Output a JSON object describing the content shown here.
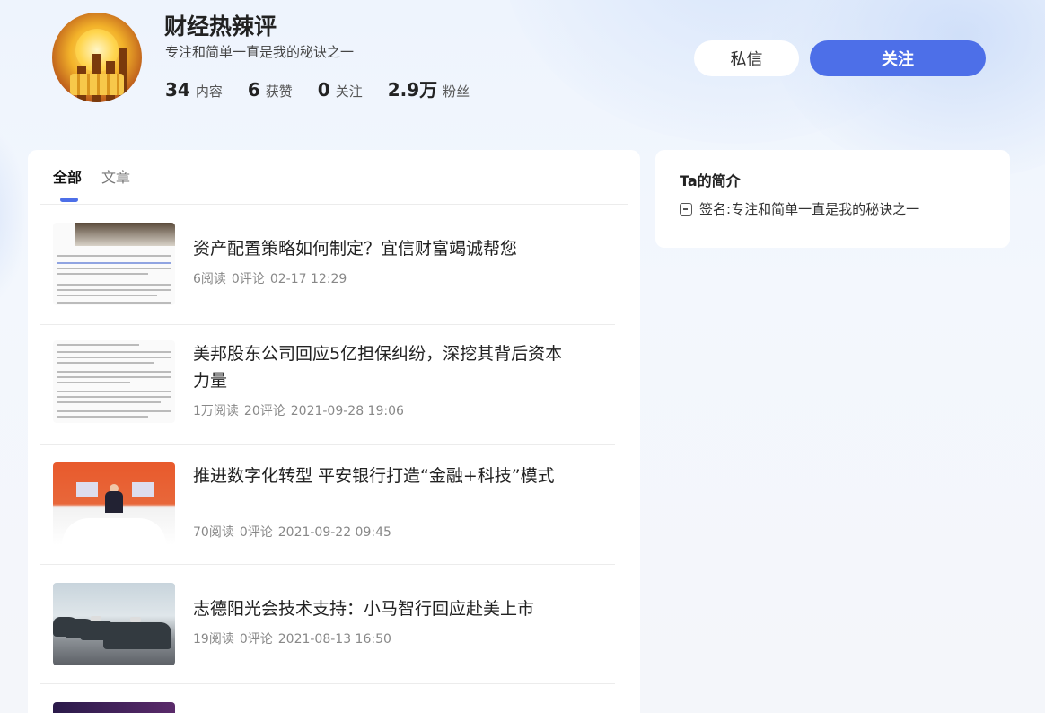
{
  "profile": {
    "name": "财经热辣评",
    "signature": "专注和简单一直是我的秘诀之一",
    "stats": [
      {
        "value": "34",
        "label": "内容"
      },
      {
        "value": "6",
        "label": "获赞"
      },
      {
        "value": "0",
        "label": "关注"
      },
      {
        "value": "2.9万",
        "label": "粉丝"
      }
    ]
  },
  "actions": {
    "message_label": "私信",
    "follow_label": "关注"
  },
  "tabs": [
    {
      "label": "全部",
      "active": true
    },
    {
      "label": "文章",
      "active": false
    }
  ],
  "articles": [
    {
      "title": "资产配置策略如何制定？宜信财富竭诚帮您",
      "reads": "6阅读",
      "comments": "0评论",
      "time": "02-17 12:29"
    },
    {
      "title": "美邦股东公司回应5亿担保纠纷，深挖其背后资本力量",
      "reads": "1万阅读",
      "comments": "20评论",
      "time": "2021-09-28 19:06"
    },
    {
      "title": "推进数字化转型 平安银行打造“金融+科技”模式",
      "reads": "70阅读",
      "comments": "0评论",
      "time": "2021-09-22 09:45"
    },
    {
      "title": "志德阳光会技术支持：小马智行回应赴美上市",
      "reads": "19阅读",
      "comments": "0评论",
      "time": "2021-08-13 16:50"
    }
  ],
  "intro": {
    "heading": "Ta的简介",
    "signature_label": "签名: ",
    "signature_value": "专注和简单一直是我的秘诀之一"
  },
  "colors": {
    "accent": "#4d6fe8",
    "background": "#f2f6fc"
  }
}
